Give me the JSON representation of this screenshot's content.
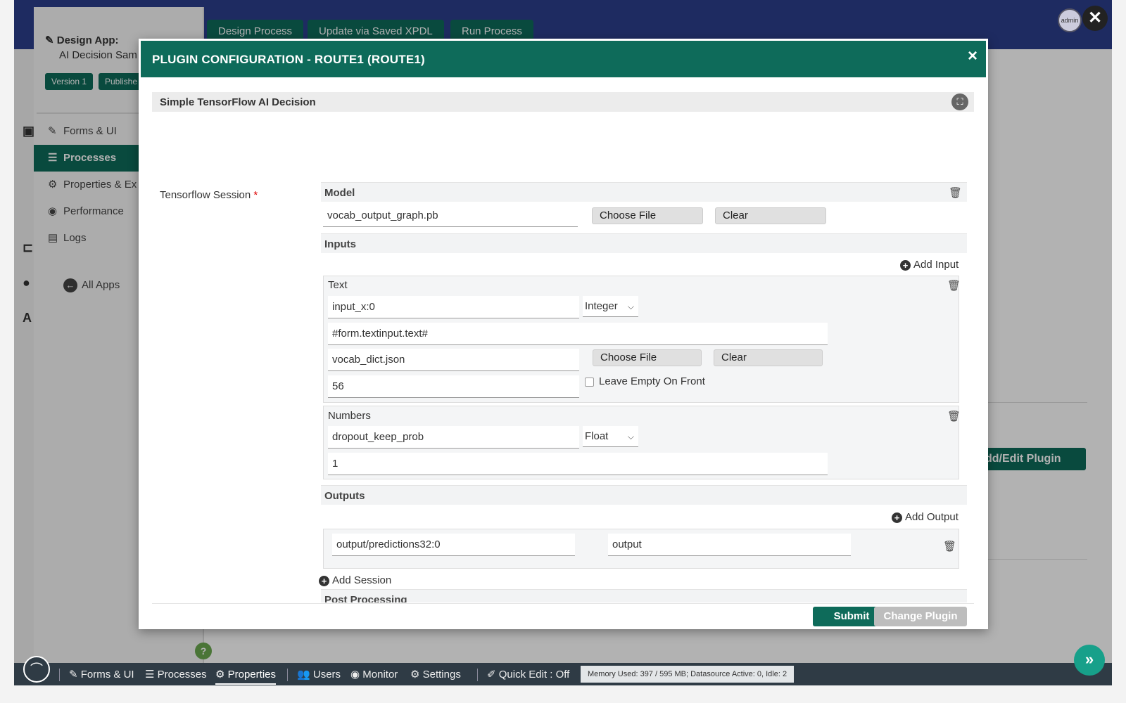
{
  "background": {
    "design_label": "Design App:",
    "app_name": "AI Decision Sam",
    "version_badge": "Version 1",
    "published_badge": "Publishe",
    "side_items": [
      {
        "label": "Forms & UI",
        "icon": "edit-icon"
      },
      {
        "label": "Processes",
        "icon": "list-icon"
      },
      {
        "label": "Properties & Ex",
        "icon": "gear-icon"
      },
      {
        "label": "Performance",
        "icon": "dashboard-icon"
      },
      {
        "label": "Logs",
        "icon": "scroll-icon"
      }
    ],
    "all_apps": "All Apps",
    "top_tabs": [
      "Design Process",
      "Update via Saved XPDL",
      "Run Process"
    ],
    "add_edit_plugin": "dd/Edit Plugin",
    "help": "?"
  },
  "modal": {
    "title": "PLUGIN CONFIGURATION - ROUTE1 (ROUTE1)",
    "close": "×",
    "plugin_name": "Simple TensorFlow AI Decision",
    "session_label": "Tensorflow Session",
    "required_mark": "*",
    "model": {
      "heading": "Model",
      "file": "vocab_output_graph.pb",
      "choose_file": "Choose File",
      "clear": "Clear"
    },
    "inputs": {
      "heading": "Inputs",
      "add_input": "Add Input",
      "text_group": {
        "label": "Text",
        "name": "input_x:0",
        "type": "Integer",
        "value": "#form.textinput.text#",
        "dict_file": "vocab_dict.json",
        "choose_file": "Choose File",
        "clear": "Clear",
        "length": "56",
        "leave_empty": "Leave Empty On Front"
      },
      "numbers_group": {
        "label": "Numbers",
        "name": "dropout_keep_prob",
        "type": "Float",
        "value": "1"
      }
    },
    "outputs": {
      "heading": "Outputs",
      "add_output": "Add Output",
      "name": "output/predictions32:0",
      "variable": "output"
    },
    "add_session": "Add Session",
    "post_processing": "Post Processing",
    "submit": "Submit",
    "change_plugin": "Change Plugin"
  },
  "bottom_bar": {
    "items": [
      {
        "label": "Forms & UI",
        "icon": "edit-icon"
      },
      {
        "label": "Processes",
        "icon": "list-icon"
      },
      {
        "label": "Properties",
        "icon": "gear-icon"
      },
      {
        "label": "Users",
        "icon": "users-icon"
      },
      {
        "label": "Monitor",
        "icon": "dashboard-icon"
      },
      {
        "label": "Settings",
        "icon": "gears-icon"
      },
      {
        "label": "Quick Edit : Off",
        "icon": "pencil-icon"
      }
    ],
    "memory": "Memory Used: 397 / 595 MB; Datasource Active: 0, Idle: 2"
  },
  "avatar_text": "admin",
  "colors": {
    "accent": "#0e6b5a",
    "brand_top": "#2c3e8c",
    "bottom_bar": "#2f3b45"
  }
}
